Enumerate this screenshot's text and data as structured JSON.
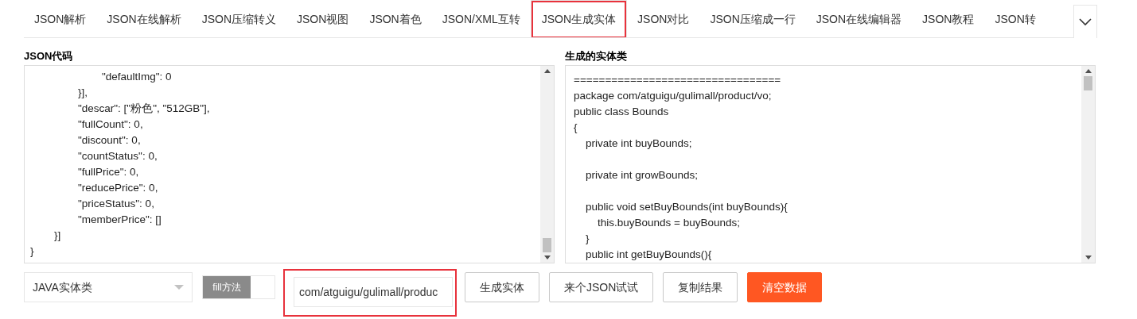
{
  "tabs": [
    {
      "label": "JSON解析",
      "selected": false,
      "highlighted": false
    },
    {
      "label": "JSON在线解析",
      "selected": false,
      "highlighted": false
    },
    {
      "label": "JSON压缩转义",
      "selected": false,
      "highlighted": false
    },
    {
      "label": "JSON视图",
      "selected": false,
      "highlighted": false
    },
    {
      "label": "JSON着色",
      "selected": false,
      "highlighted": false
    },
    {
      "label": "JSON/XML互转",
      "selected": false,
      "highlighted": false
    },
    {
      "label": "JSON生成实体",
      "selected": true,
      "highlighted": true
    },
    {
      "label": "JSON对比",
      "selected": false,
      "highlighted": false
    },
    {
      "label": "JSON压缩成一行",
      "selected": false,
      "highlighted": false
    },
    {
      "label": "JSON在线编辑器",
      "selected": false,
      "highlighted": false
    },
    {
      "label": "JSON教程",
      "selected": false,
      "highlighted": false
    },
    {
      "label": "JSON转",
      "selected": false,
      "highlighted": false
    }
  ],
  "input_panel": {
    "title": "JSON代码",
    "lines": [
      "\t\t\t\"defaultImg\": 0",
      "\t\t}],",
      "\t\t\"descar\": [\"粉色\", \"512GB\"],",
      "\t\t\"fullCount\": 0,",
      "\t\t\"discount\": 0,",
      "\t\t\"countStatus\": 0,",
      "\t\t\"fullPrice\": 0,",
      "\t\t\"reducePrice\": 0,",
      "\t\t\"priceStatus\": 0,",
      "\t\t\"memberPrice\": []",
      "\t}]",
      "}"
    ]
  },
  "output_panel": {
    "title": "生成的实体类",
    "blocks": [
      [
        "=================================",
        "package com/atguigu/gulimall/product/vo;",
        "public class Bounds",
        "{",
        "\tprivate int buyBounds;"
      ],
      [
        "\tprivate int growBounds;"
      ],
      [
        "\tpublic void setBuyBounds(int buyBounds){",
        "\t\tthis.buyBounds = buyBounds;",
        "\t}",
        "\tpublic int getBuyBounds(){"
      ]
    ]
  },
  "controls": {
    "language_select": {
      "value": "JAVA实体类"
    },
    "fill_toggle": {
      "label": "fill方法",
      "on": false
    },
    "package_field": {
      "value": "com/atguigu/gulimall/produc",
      "highlighted": true
    },
    "buttons": [
      {
        "label": "生成实体",
        "kind": "plain"
      },
      {
        "label": "来个JSON试试",
        "kind": "plain"
      },
      {
        "label": "复制结果",
        "kind": "plain"
      },
      {
        "label": "清空数据",
        "kind": "primary"
      }
    ]
  }
}
